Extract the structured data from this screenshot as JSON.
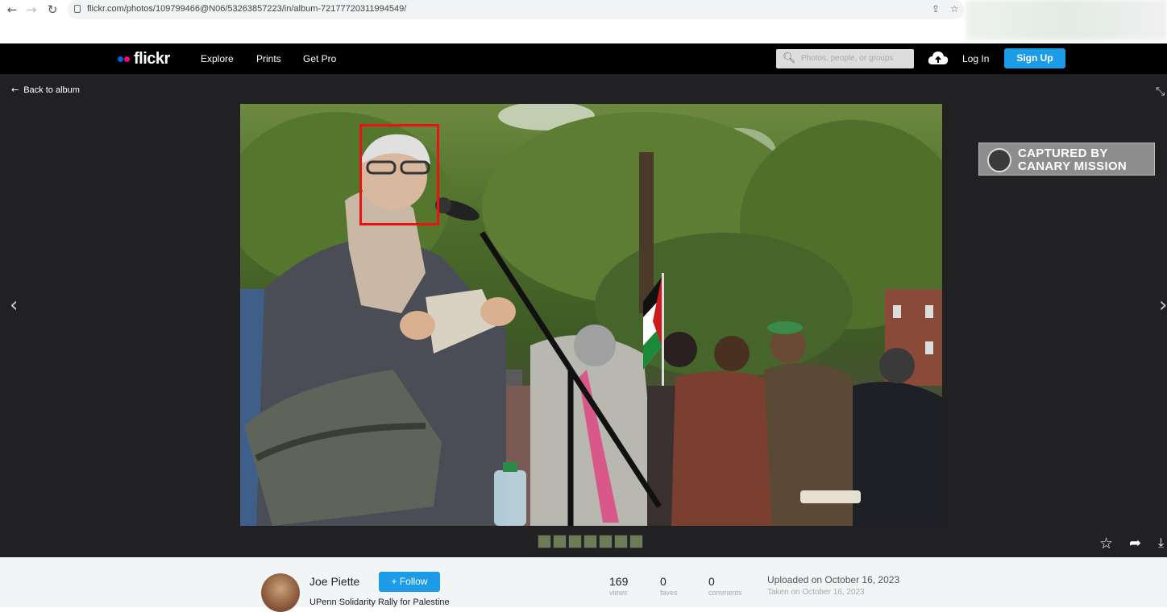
{
  "browser": {
    "url": "flickr.com/photos/109799466@N06/53263857223/in/album-72177720311994549/"
  },
  "nav": {
    "logo": "flickr",
    "links": [
      "Explore",
      "Prints",
      "Get Pro"
    ],
    "search_placeholder": "Photos, people, or groups",
    "login": "Log In",
    "signup": "Sign Up"
  },
  "photo_page": {
    "back_label": "Back to album"
  },
  "watermark": {
    "line1": "CAPTURED BY",
    "line2": "CANARY MISSION"
  },
  "info": {
    "author": "Joe Piette",
    "follow": "+ Follow",
    "title": "UPenn Solidarity Rally for Palestine",
    "stats": [
      {
        "num": "169",
        "label": "views"
      },
      {
        "num": "0",
        "label": "faves"
      },
      {
        "num": "0",
        "label": "comments"
      }
    ],
    "uploaded": "Uploaded on October 16, 2023",
    "taken": "Taken on October 16, 2023"
  },
  "colors": {
    "flickr_blue": "#1c9be9",
    "flickr_pink": "#ff0084",
    "flickr_dot_blue": "#0063dc",
    "face_box": "#ee1111"
  }
}
